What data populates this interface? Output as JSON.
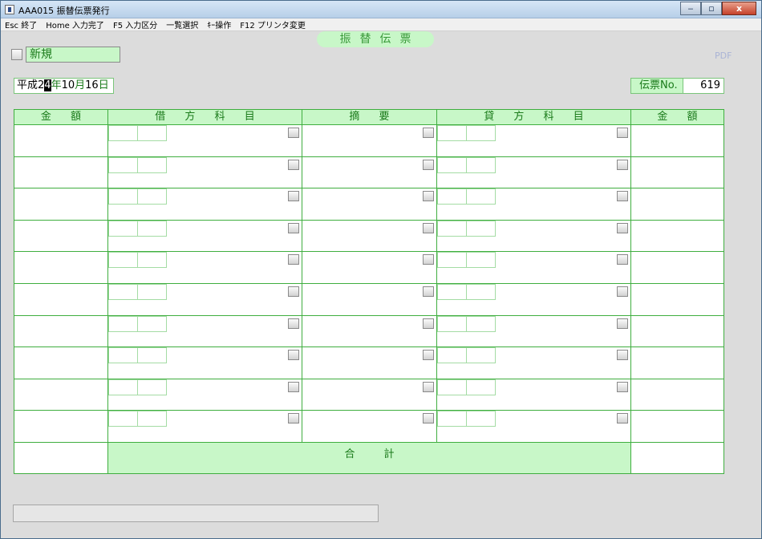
{
  "window": {
    "title": "AAA015 振替伝票発行",
    "minimize": "‒",
    "maximize": "▫",
    "close": "x"
  },
  "menu": [
    "Esc 終了",
    "Home 入力完了",
    "F5 入力区分",
    "一覧選択",
    "ｷｰ操作",
    "F12 プリンタ変更"
  ],
  "form": {
    "title": "振替伝票",
    "pdf_label": "PDF",
    "new_label": "新規",
    "date": {
      "era": "平成",
      "year_digit1": "2",
      "year_digit2": "4",
      "year_unit": "年",
      "month": "10",
      "month_unit": "月",
      "day": "16",
      "day_unit": "日"
    },
    "slip_no_label": "伝票No.",
    "slip_no_value": "619"
  },
  "table": {
    "headers": {
      "amount_left": "金 額",
      "debit_account": "借 方 科 目",
      "summary": "摘  要",
      "credit_account": "貸 方 科 目",
      "amount_right": "金 額"
    },
    "total_label": "合計",
    "row_count": 10
  },
  "colors": {
    "header_bg": "#c8f7c8",
    "grid_line": "#3fae3f",
    "label_text": "#1a7a1a"
  }
}
